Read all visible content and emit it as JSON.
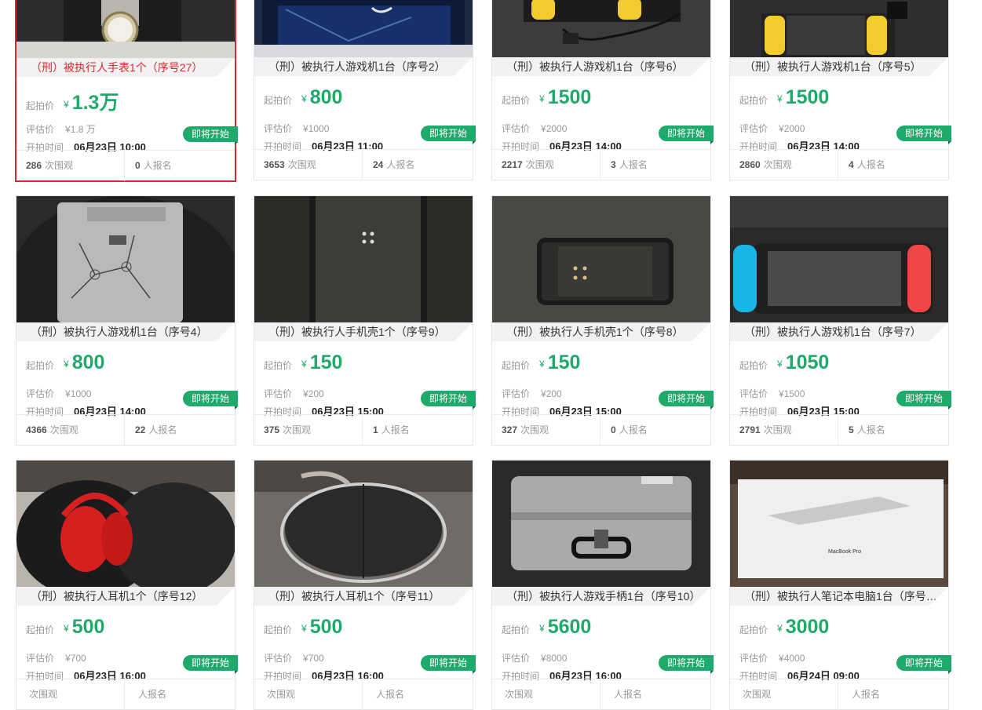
{
  "labels": {
    "start_price": "起拍价",
    "eval_price": "评估价",
    "start_time": "开拍时间",
    "currency": "¥",
    "views_suffix": "次围观",
    "signups_suffix": "人报名",
    "status_badge": "即将开始"
  },
  "colors": {
    "price_green": "#1fa96b",
    "selected_red": "#d9282d"
  },
  "items": [
    {
      "title": "（刑）被执行人手表1个（序号27）",
      "start_price": "1.3万",
      "eval_price": "¥1.8 万",
      "start_time": "06月23日 10:00",
      "views": "286",
      "signups": "0",
      "image": "watch-photo",
      "selected": true
    },
    {
      "title": "（刑）被执行人游戏机1台（序号2）",
      "start_price": "800",
      "eval_price": "¥1000",
      "start_time": "06月23日 11:00",
      "views": "3653",
      "signups": "24",
      "image": "game-console-screen-photo"
    },
    {
      "title": "（刑）被执行人游戏机1台（序号6）",
      "start_price": "1500",
      "eval_price": "¥2000",
      "start_time": "06月23日 14:00",
      "views": "2217",
      "signups": "3",
      "image": "game-console-yellow-photo"
    },
    {
      "title": "（刑）被执行人游戏机1台（序号5）",
      "start_price": "1500",
      "eval_price": "¥2000",
      "start_time": "06月23日 14:00",
      "views": "2860",
      "signups": "4",
      "image": "switch-yellow-photo"
    },
    {
      "title": "（刑）被执行人游戏机1台（序号4）",
      "start_price": "800",
      "eval_price": "¥1000",
      "start_time": "06月23日 14:00",
      "views": "4366",
      "signups": "22",
      "image": "console-panel-photo"
    },
    {
      "title": "（刑）被执行人手机壳1个（序号9）",
      "start_price": "150",
      "eval_price": "¥200",
      "start_time": "06月23日 15:00",
      "views": "375",
      "signups": "1",
      "image": "phone-case-back-photo"
    },
    {
      "title": "（刑）被执行人手机壳1个（序号8）",
      "start_price": "150",
      "eval_price": "¥200",
      "start_time": "06月23日 15:00",
      "views": "327",
      "signups": "0",
      "image": "phone-case-frame-photo"
    },
    {
      "title": "（刑）被执行人游戏机1台（序号7）",
      "start_price": "1050",
      "eval_price": "¥1500",
      "start_time": "06月23日 15:00",
      "views": "2791",
      "signups": "5",
      "image": "switch-red-blue-photo"
    },
    {
      "title": "（刑）被执行人耳机1个（序号12）",
      "start_price": "500",
      "eval_price": "¥700",
      "start_time": "06月23日 16:00",
      "views": "",
      "signups": "",
      "image": "red-headphones-photo"
    },
    {
      "title": "（刑）被执行人耳机1个（序号11）",
      "start_price": "500",
      "eval_price": "¥700",
      "start_time": "06月23日 16:00",
      "views": "",
      "signups": "",
      "image": "headphone-case-photo"
    },
    {
      "title": "（刑）被执行人游戏手柄1台（序号10）",
      "start_price": "5600",
      "eval_price": "¥8000",
      "start_time": "06月23日 16:00",
      "views": "",
      "signups": "",
      "image": "aluminum-case-photo"
    },
    {
      "title": "（刑）被执行人笔记本电脑1台（序号…",
      "start_price": "3000",
      "eval_price": "¥4000",
      "start_time": "06月24日 09:00",
      "views": "",
      "signups": "",
      "image": "macbook-box-photo",
      "photo_text": "MacBook Pro"
    }
  ]
}
